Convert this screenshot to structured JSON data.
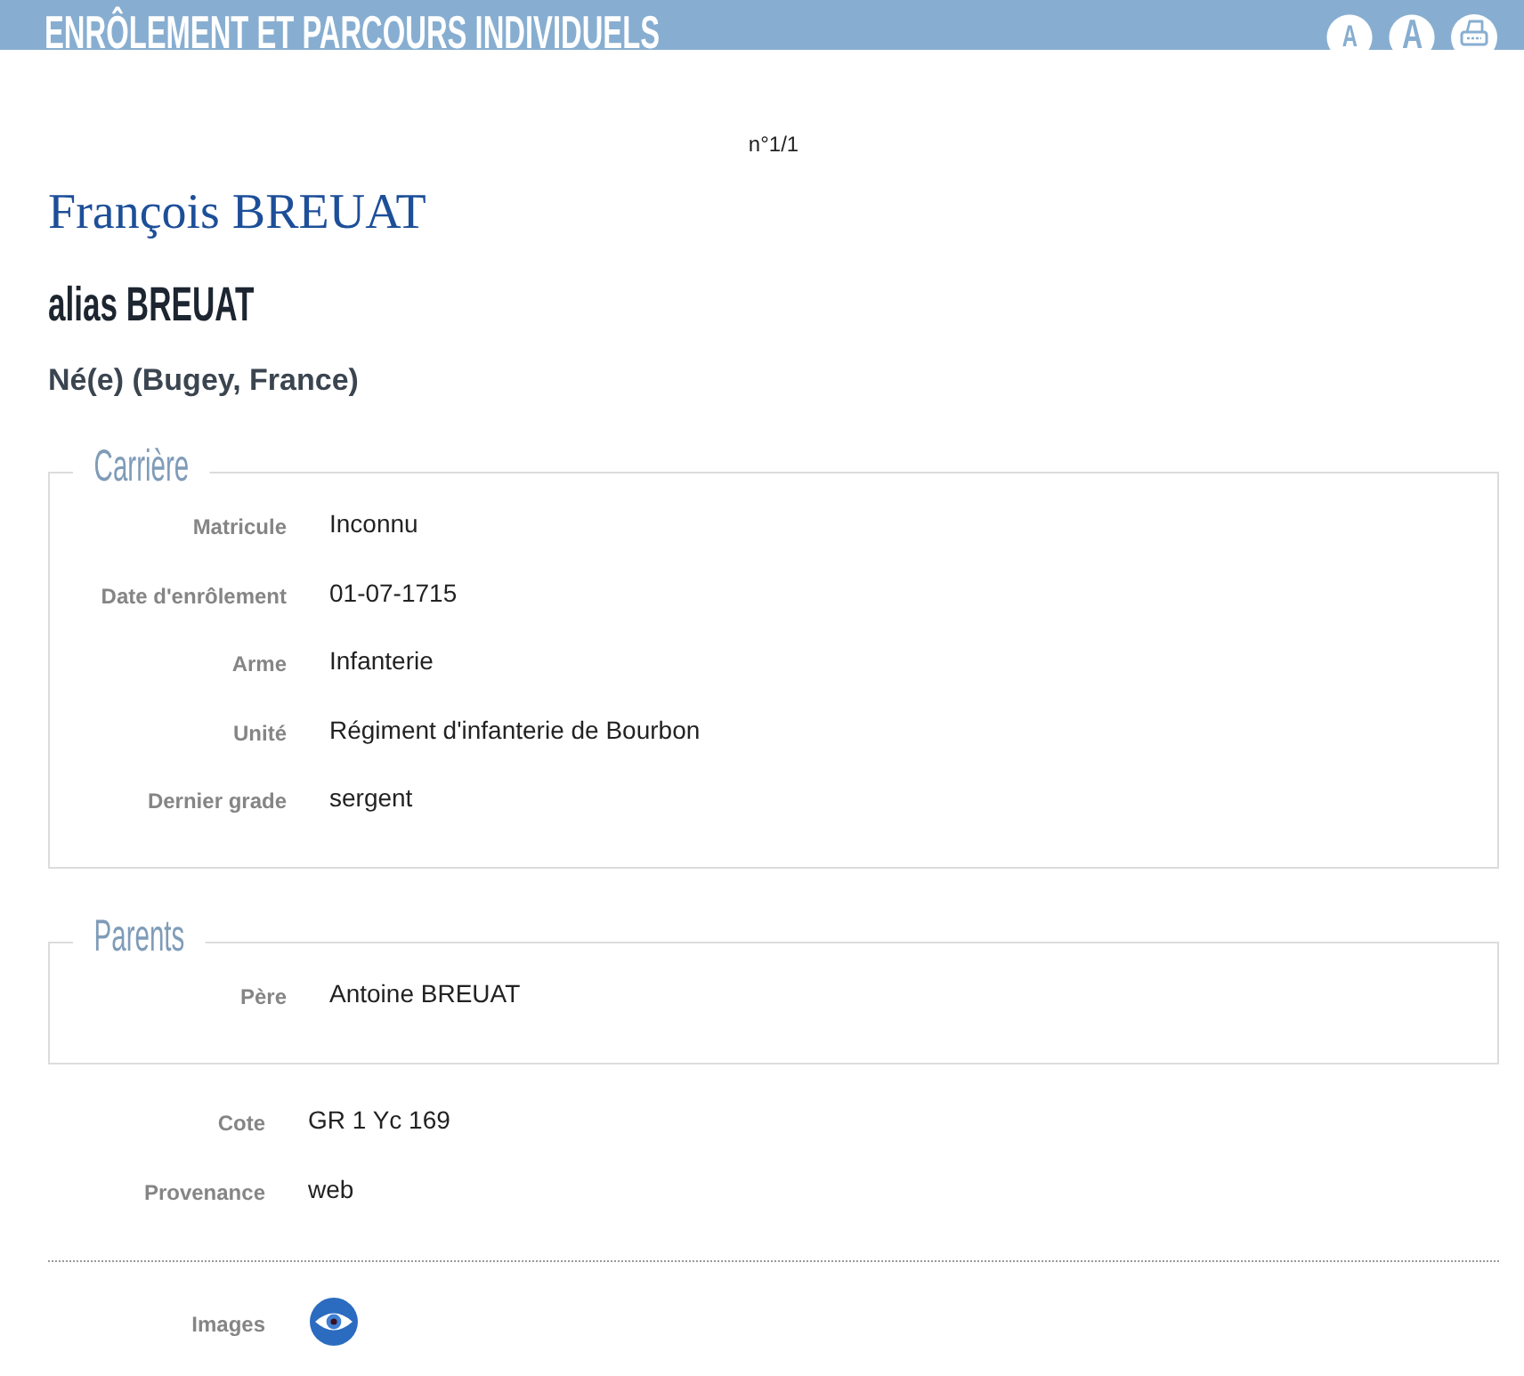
{
  "header": {
    "title": "ENRÔLEMENT ET PARCOURS INDIVIDUELS",
    "buttons": [
      {
        "kind": "font-small",
        "label": "A"
      },
      {
        "kind": "font-large",
        "label": "A"
      },
      {
        "kind": "print"
      }
    ]
  },
  "record_counter": "n°1/1",
  "person": {
    "name": "François BREUAT",
    "alias": "alias BREUAT",
    "birth": "Né(e) (Bugey, France)"
  },
  "sections": [
    {
      "title": "Carrière",
      "fields": [
        {
          "label": "Matricule",
          "value": "Inconnu"
        },
        {
          "label": "Date d'enrôlement",
          "value": "01-07-1715"
        },
        {
          "label": "Arme",
          "value": "Infanterie"
        },
        {
          "label": "Unité",
          "value": "Régiment d'infanterie de Bourbon"
        },
        {
          "label": "Dernier grade",
          "value": "sergent"
        }
      ]
    },
    {
      "title": "Parents",
      "fields": [
        {
          "label": "Père",
          "value": "Antoine BREUAT"
        }
      ]
    }
  ],
  "details": [
    {
      "label": "Cote",
      "value": "GR 1 Yc 169"
    },
    {
      "label": "Provenance",
      "value": "web"
    }
  ],
  "images": {
    "label": "Images"
  }
}
